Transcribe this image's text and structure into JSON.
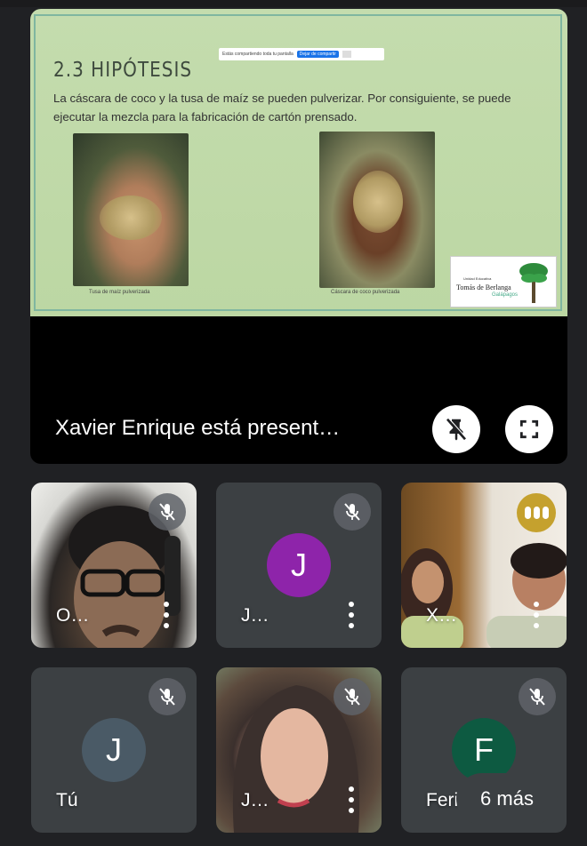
{
  "presentation": {
    "slide": {
      "title": "2.3 HIPÓTESIS",
      "share_bar_text": "Estás compartiendo toda tu pantalla",
      "share_bar_stop": "Dejar de compartir",
      "body": "La cáscara de coco y la tusa de maíz se pueden pulverizar. Por consiguiente, se puede ejecutar la mezcla para la fabricación de cartón prensado.",
      "caption_left": "Tusa de maíz pulverizada",
      "caption_right": "Cáscara de coco pulverizada",
      "logo_line1": "Unidad Educativa",
      "logo_line2": "Tomás de Berlanga",
      "logo_line3": "Galápagos"
    },
    "presenter_label": "Xavier Enrique está present…"
  },
  "participants": [
    {
      "name": "O…",
      "muted": true
    },
    {
      "name": "J…",
      "initial": "J",
      "muted": true,
      "color": "#8e24aa"
    },
    {
      "name": "X…",
      "speaking": true
    },
    {
      "name": "Tú",
      "initial": "J",
      "muted": true,
      "color": "#4a5a66"
    },
    {
      "name": "J…",
      "muted": true
    },
    {
      "name": "Feria de…",
      "initial": "F",
      "muted": true,
      "color": "#0d5a41"
    }
  ],
  "more_label": "6 más",
  "colors": {
    "background": "#202124",
    "tile": "#3c4043",
    "speaking": "#c5a12e"
  }
}
